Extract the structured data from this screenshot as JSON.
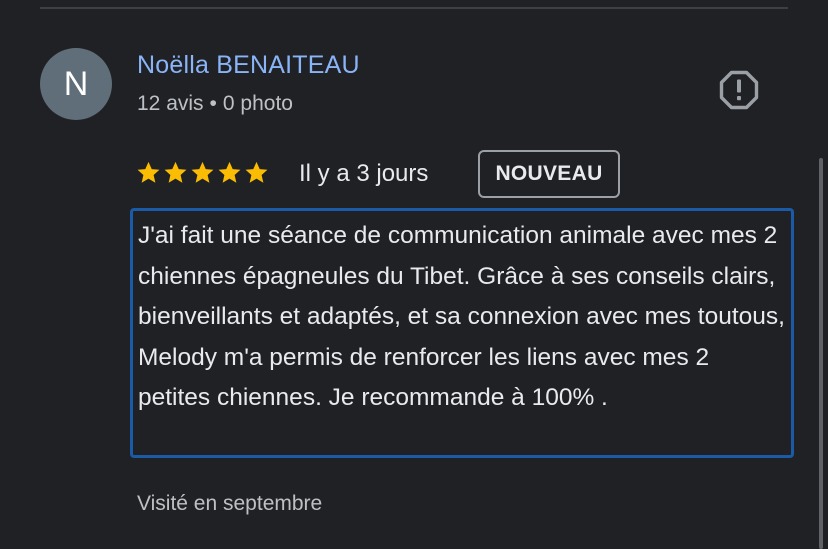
{
  "review": {
    "author_initial": "N",
    "author_name": "Noëlla BENAITEAU",
    "reviews_count": "12 avis",
    "separator": "•",
    "photos_count": "0 photo",
    "rating": 5,
    "rating_max": 5,
    "date": "Il y a 3 jours",
    "badge": "NOUVEAU",
    "text": "J'ai fait une séance de communication animale avec mes 2 chiennes épagneules du Tibet. Grâce à ses conseils clairs, bienveillants et adaptés, et sa connexion avec mes toutous, Melody m'a permis de renforcer les liens avec mes 2 petites chiennes. Je recommande à 100% .",
    "visited": "Visité en septembre"
  },
  "icons": {
    "report": "report-flag-icon",
    "star": "star-icon"
  },
  "colors": {
    "background": "#202124",
    "author_link": "#8ab4f8",
    "star": "#fbbc04",
    "highlight_border": "#1a5aa6",
    "avatar_bg": "#5f6e78"
  }
}
